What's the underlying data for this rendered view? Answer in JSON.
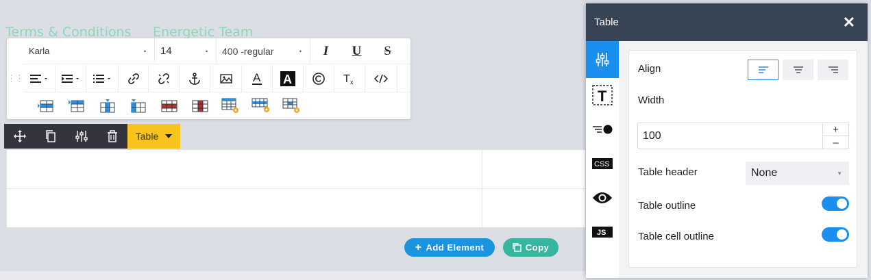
{
  "canvas": {
    "links": [
      "Terms & Conditions",
      "Energetic Team"
    ]
  },
  "toolbar": {
    "font_family": "Karla",
    "font_size": "14",
    "font_weight": "400 -regular",
    "format_buttons": [
      "italic-icon",
      "underline-icon",
      "strikethrough-icon"
    ],
    "row2_icons": [
      "align-left-icon",
      "indent-icon",
      "list-icon",
      "link-icon",
      "unlink-icon",
      "anchor-icon",
      "image-icon",
      "text-color-icon",
      "background-color-icon",
      "copyright-icon",
      "clear-format-icon",
      "code-icon"
    ],
    "row3_icons": [
      "insert-row-above-icon",
      "insert-row-below-icon",
      "insert-column-left-icon",
      "insert-column-right-icon",
      "delete-row-icon",
      "delete-column-icon",
      "table-settings-icon",
      "row-settings-icon",
      "cell-settings-icon"
    ]
  },
  "action_bar": {
    "icons": [
      "move-icon",
      "duplicate-icon",
      "settings-icon",
      "delete-icon"
    ],
    "dropdown_label": "Table"
  },
  "buttons": {
    "add_element": "Add Element",
    "copy": "Copy"
  },
  "panel": {
    "title": "Table",
    "tabs": [
      "settings-icon",
      "text-icon",
      "list-bullet-icon",
      "css-icon",
      "visibility-icon",
      "js-icon"
    ],
    "tab_labels": {
      "css": "CSS",
      "js": "JS",
      "text": "T"
    },
    "align_label": "Align",
    "align_options": [
      "align-left-icon",
      "align-center-icon",
      "align-right-icon"
    ],
    "align_selected": "left",
    "width_label": "Width",
    "width_value": "100",
    "table_header_label": "Table header",
    "table_header_value": "None",
    "table_outline_label": "Table outline",
    "table_outline_on": true,
    "table_cell_outline_label": "Table cell outline",
    "table_cell_outline_on": true
  },
  "colors": {
    "panel_header": "#374456",
    "accent_blue": "#1a8ff0",
    "add_button": "#1a94e0",
    "copy_button": "#36b59f",
    "dropdown_yellow": "#f9c31f",
    "link_green": "#8ed6b8"
  }
}
